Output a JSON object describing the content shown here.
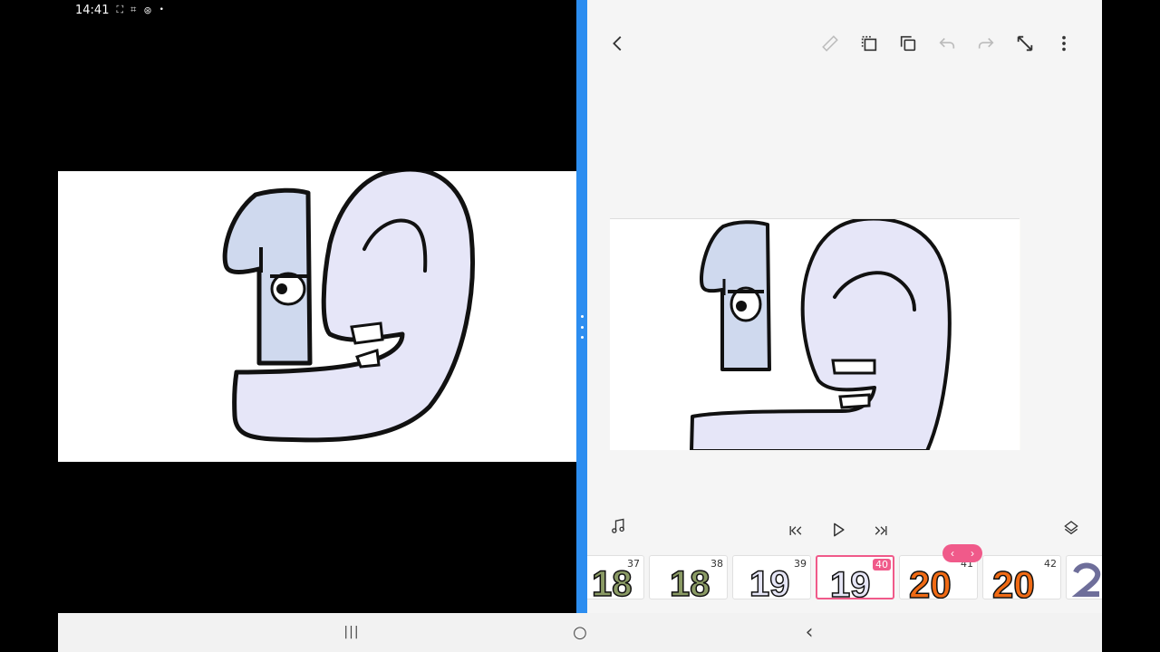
{
  "status_bar": {
    "time": "14:41",
    "icons": [
      "⛶",
      "⌗",
      "⊛"
    ],
    "dot": "•"
  },
  "timeline": {
    "frames": [
      {
        "number": "37",
        "character": "18",
        "color": "#8a9a64"
      },
      {
        "number": "38",
        "character": "18",
        "color": "#8a9a64"
      },
      {
        "number": "39",
        "character": "19",
        "color": "#e6e6f6"
      },
      {
        "number": "40",
        "character": "19",
        "color": "#e6e6f6",
        "selected": true
      },
      {
        "number": "41",
        "character": "20",
        "color": "#f06a14"
      },
      {
        "number": "42",
        "character": "20",
        "color": "#f06a14"
      }
    ]
  },
  "colors": {
    "divider": "#2c8df0",
    "accent": "#f05a8a",
    "figure_fill": "#e6e6f8",
    "one_fill": "#cfd9ee"
  },
  "icons": {
    "back": "chevron-left-icon",
    "ruler": "ruler-icon",
    "copy_frame": "copy-frame-icon",
    "duplicate": "duplicate-icon",
    "undo": "undo-icon",
    "redo": "redo-icon",
    "fullscreen": "expand-icon",
    "more": "more-vertical-icon",
    "music": "music-note-icon",
    "first_frame": "skip-to-start-icon",
    "play": "play-icon",
    "last_frame": "skip-to-end-icon",
    "layers": "layers-icon"
  },
  "nav_pill": {
    "prev": "‹",
    "next": "›"
  },
  "nav_bar": {
    "recents": "|||",
    "home": "○",
    "back": "‹"
  }
}
